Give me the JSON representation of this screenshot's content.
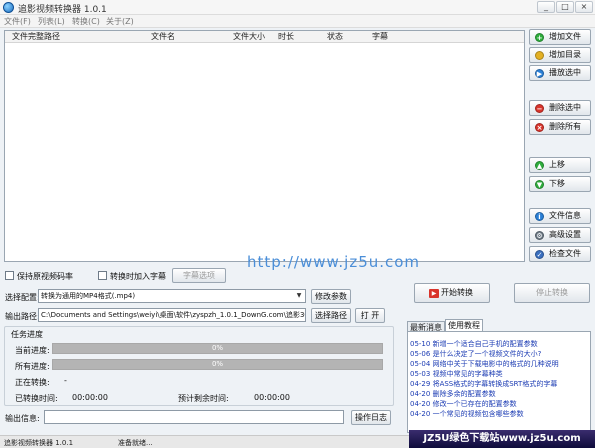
{
  "window": {
    "title": "追影视频转换器 1.0.1",
    "controls": [
      "_",
      "□",
      "×"
    ]
  },
  "menu": [
    "文件(F)",
    "列表(L)",
    "转换(C)",
    "关于(Z)"
  ],
  "list": {
    "columns": [
      "文件完整路径",
      "文件名",
      "文件大小",
      "时长",
      "状态",
      "字幕"
    ]
  },
  "side_buttons": [
    {
      "label": "增加文件",
      "icon": "add-icon",
      "color": "#2fae3c",
      "glyph": "+"
    },
    {
      "label": "增加目录",
      "icon": "folder-icon",
      "color": "#e3b024",
      "glyph": ""
    },
    {
      "label": "播放选中",
      "icon": "play-icon",
      "color": "#2a7fd6",
      "glyph": "▶"
    },
    {
      "label": "删除选中",
      "icon": "remove-icon",
      "color": "#d9342b",
      "glyph": "−"
    },
    {
      "label": "删除所有",
      "icon": "delete-all-icon",
      "color": "#d9342b",
      "glyph": "×"
    },
    {
      "label": "上移",
      "icon": "up-icon",
      "color": "#2fae3c",
      "glyph": "▲"
    },
    {
      "label": "下移",
      "icon": "down-icon",
      "color": "#2fae3c",
      "glyph": "▼"
    },
    {
      "label": "文件信息",
      "icon": "info-icon",
      "color": "#2a7fd6",
      "glyph": "i"
    },
    {
      "label": "高级设置",
      "icon": "settings-icon",
      "color": "#6d7a86",
      "glyph": "⚙"
    },
    {
      "label": "检查文件",
      "icon": "check-icon",
      "color": "#3a6fbf",
      "glyph": "✓"
    }
  ],
  "watermark": "http://www.jz5u.com",
  "options": {
    "keep_bitrate": "保持原视频码率",
    "add_subtitle": "转换时加入字幕",
    "subtitle_options": "字幕选项"
  },
  "config": {
    "label": "选择配置:",
    "value": "转换为通用的MP4格式(.mp4)",
    "edit": "修改参数"
  },
  "output_path": {
    "label": "输出路径:",
    "value": "C:\\Documents and Settings\\weiyi\\桌面\\软件\\zyspzh_1.0.1_DownG.com\\追影3GP-MP4",
    "choose": "选择路径",
    "open": "打 开"
  },
  "actions": {
    "start": "开始转换",
    "stop": "停止转换"
  },
  "progress": {
    "group": "任务进度",
    "current_label": "当前进度:",
    "current_value": "0%",
    "all_label": "所有进度:",
    "all_value": "0%",
    "converting_label": "正在转换:",
    "converting_value": "-",
    "elapsed_label": "已转换时间:",
    "elapsed_value": "00:00:00",
    "remaining_label": "预计剩余时间:",
    "remaining_value": "00:00:00"
  },
  "output_info": {
    "label": "输出信息:",
    "log_button": "操作日志"
  },
  "tabs": [
    "最新消息",
    "使用教程"
  ],
  "news": [
    "05-10 新增一个适合自己手机的配置参数",
    "05-06 是什么决定了一个视频文件的大小?",
    "05-04 网络中关于下载电影中的格式的几种说明",
    "05-03 视频中常见的字幕种类",
    "04-29 将ASS格式的字幕转换成SRT格式的字幕",
    "04-20 删除多余的配置参数",
    "04-20 修改一个已存在的配置参数",
    "04-20 一个常见的视频包含哪些参数"
  ],
  "status": {
    "app": "追影视频转换器 1.0.1",
    "state": "准备就绪..."
  },
  "brand": "JZ5U绿色下载站www.jz5u.com"
}
